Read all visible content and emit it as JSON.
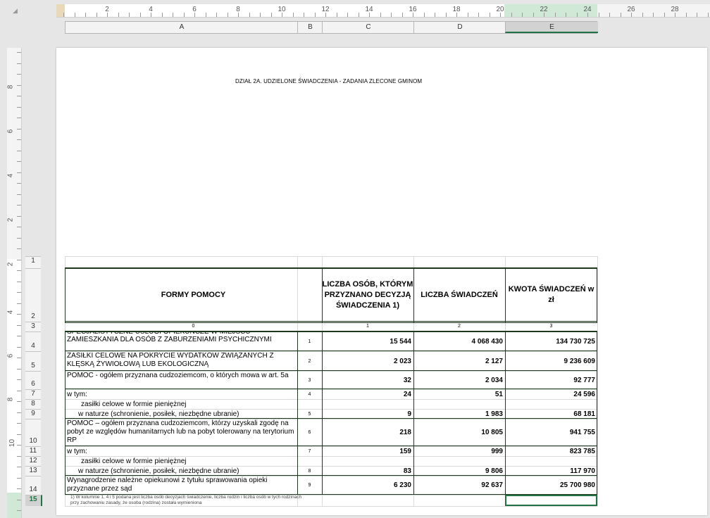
{
  "ruler_h": {
    "numbers": [
      "2",
      "4",
      "6",
      "8",
      "10",
      "12",
      "14",
      "16",
      "18",
      "20",
      "22",
      "24",
      "26",
      "28"
    ]
  },
  "ruler_v": {
    "numbers": [
      "8",
      "6",
      "4",
      "2",
      "2",
      "4",
      "6",
      "8",
      "10"
    ]
  },
  "columns": [
    "A",
    "B",
    "C",
    "D",
    "E"
  ],
  "selected_column": "E",
  "rows": [
    "1",
    "2",
    "3",
    "4",
    "5",
    "6",
    "7",
    "8",
    "9",
    "10",
    "11",
    "12",
    "13",
    "14",
    "15"
  ],
  "selected_row": "15",
  "title": "DZIAŁ 2A. UDZIELONE ŚWIADCZENIA - ZADANIA ZLECONE GMINOM",
  "table": {
    "headers": {
      "forms": "FORMY POMOCY",
      "persons": "LICZBA OSÓB, KTÓRYM PRZYZNANO DECYZJĄ ŚWIADCZENIA 1)",
      "benefits": "LICZBA ŚWIADCZEŃ",
      "amount": "KWOTA ŚWIADCZEŃ w zł"
    },
    "col_index": [
      "0",
      "1",
      "2",
      "3"
    ],
    "rows": [
      {
        "label": "SPECJALISTYCZNE USŁUGI OPIEKUŃCZE W MIEJSCU ZAMIESZKANIA DLA OSÓB Z ZABURZENIAMI PSYCHICZNYMI",
        "no": "1",
        "persons": "15 544",
        "benefits": "4 068 430",
        "amount": "134 730 725"
      },
      {
        "label": "ZASIŁKI CELOWE NA POKRYCIE WYDATKÓW ZWIĄZANYCH Z KLĘSKĄ ŻYWIOŁOWĄ LUB EKOLOGICZNĄ",
        "no": "2",
        "persons": "2 023",
        "benefits": "2 127",
        "amount": "9 236 609"
      },
      {
        "label": "POMOC - ogółem przyznana cudzoziemcom, o których mowa w art. 5a",
        "no": "3",
        "persons": "32",
        "benefits": "2 034",
        "amount": "92 777"
      },
      {
        "label": "w tym:",
        "no": "4",
        "persons": "24",
        "benefits": "51",
        "amount": "24 596"
      },
      {
        "label": "zasiłki celowe w formie pieniężnej",
        "no": "",
        "persons": "",
        "benefits": "",
        "amount": ""
      },
      {
        "label": "w naturze (schronienie, posiłek, niezbędne ubranie)",
        "no": "5",
        "persons": "9",
        "benefits": "1 983",
        "amount": "68 181"
      },
      {
        "label": "POMOC – ogółem przyznana cudzoziemcom, którzy uzyskali zgodę na pobyt ze względów humanitarnych lub na pobyt tolerowany na terytorium RP",
        "no": "6",
        "persons": "218",
        "benefits": "10 805",
        "amount": "941 755"
      },
      {
        "label": "w tym:",
        "no": "7",
        "persons": "159",
        "benefits": "999",
        "amount": "823 785"
      },
      {
        "label": "zasiłki celowe w formie pieniężnej",
        "no": "",
        "persons": "",
        "benefits": "",
        "amount": ""
      },
      {
        "label": "w naturze (schronienie, posiłek, niezbędne ubranie)",
        "no": "8",
        "persons": "83",
        "benefits": "9 806",
        "amount": "117 970"
      },
      {
        "label": "Wynagrodzenie należne opiekunowi z tytułu sprawowania opieki przyznane przez sąd",
        "no": "9",
        "persons": "6 230",
        "benefits": "92 637",
        "amount": "25 700 980"
      }
    ],
    "footnote": "1) W kolumnie 1, 4 i 5 podana jest liczba osób decyzjach świadczenie, liczba rodzin i liczba osób w tych rodzinach przy zachowaniu zasady, że osoba (rodzina) została wymieniona"
  }
}
